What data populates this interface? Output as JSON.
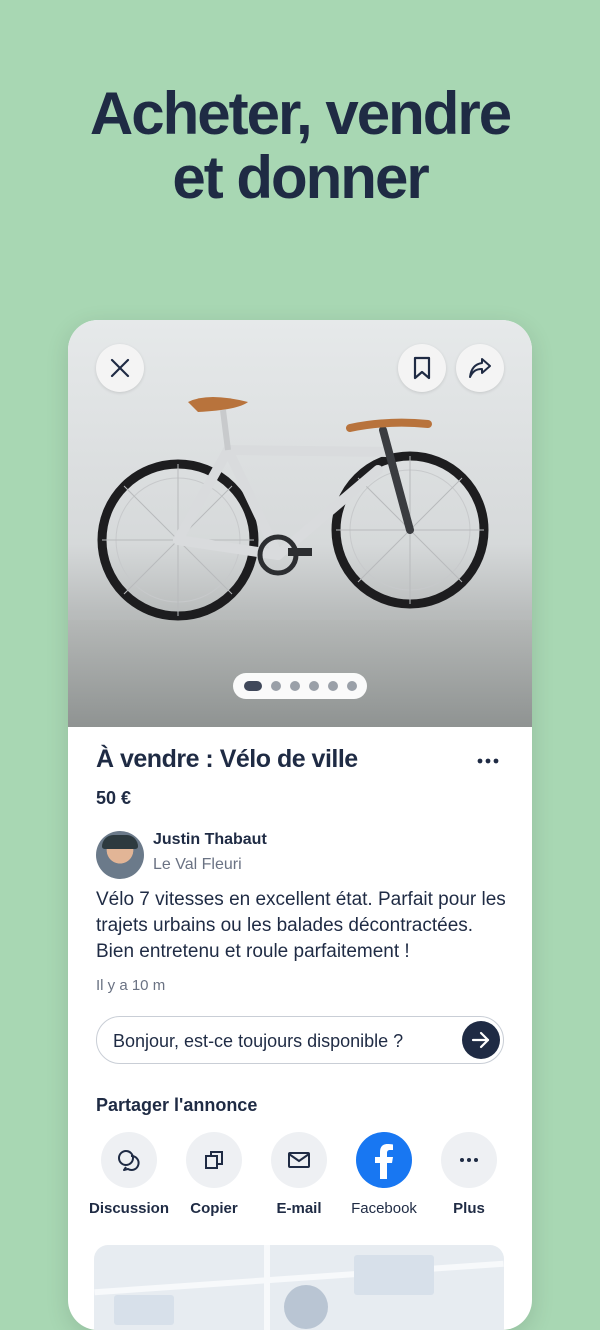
{
  "headline": {
    "line1": "Acheter, vendre",
    "line2": "et donner"
  },
  "photo": {
    "close_icon": "close-icon",
    "bookmark_icon": "bookmark-icon",
    "share_icon": "share-icon",
    "carousel": {
      "count": 6,
      "active_index": 0
    }
  },
  "listing": {
    "title": "À vendre : Vélo de ville",
    "price": "50 €",
    "more_icon": "more-horizontal-icon",
    "seller_name": "Justin Thabaut",
    "seller_location": "Le Val Fleuri",
    "description": "Vélo 7 vitesses en excellent état. Parfait pour les trajets urbains ou les balades décontractées. Bien entretenu et roule parfaitement !",
    "time": "Il y a 10 m"
  },
  "message": {
    "value": "Bonjour, est-ce toujours disponible ?",
    "send_icon": "arrow-right-icon"
  },
  "share": {
    "title": "Partager l'annonce",
    "items": [
      {
        "label": "Discussion",
        "icon": "chat-icon"
      },
      {
        "label": "Copier",
        "icon": "copy-icon"
      },
      {
        "label": "E-mail",
        "icon": "mail-icon"
      },
      {
        "label": "Facebook",
        "icon": "facebook-icon",
        "color": "#1877f2"
      },
      {
        "label": "Plus",
        "icon": "more-horizontal-icon"
      }
    ]
  },
  "colors": {
    "background": "#a8d7b3",
    "text": "#1f2b44",
    "facebook": "#1877f2"
  }
}
